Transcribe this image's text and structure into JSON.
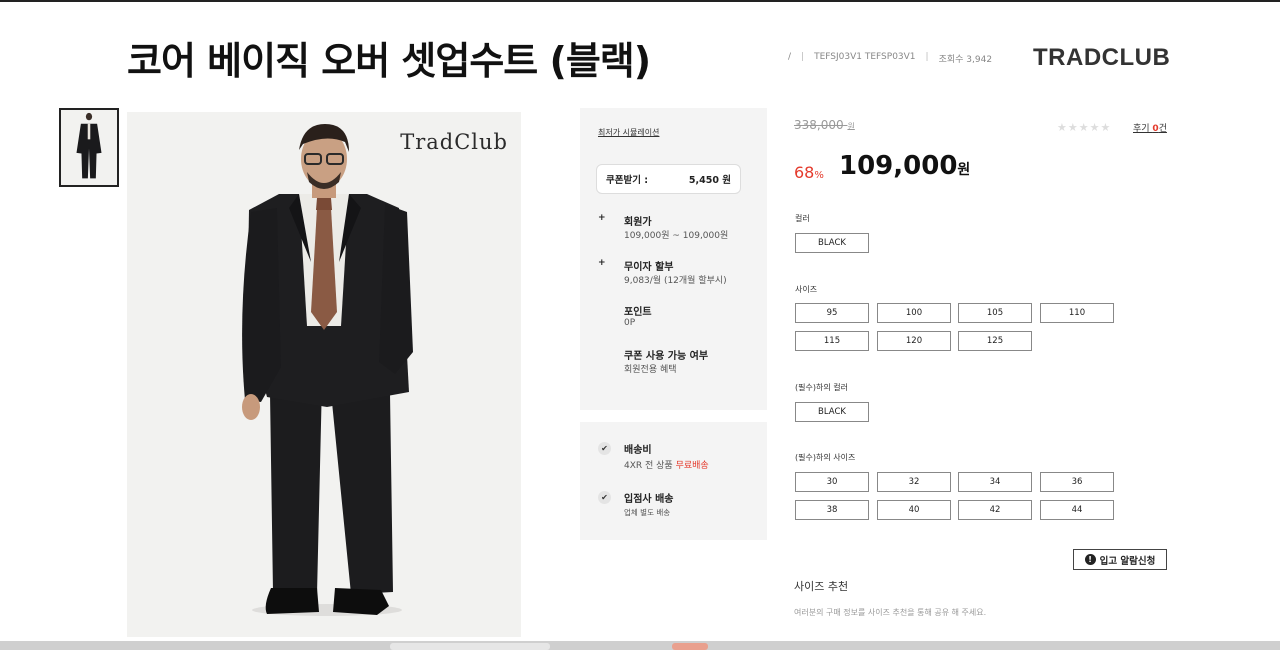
{
  "product": {
    "title": "코어 베이직 오버 셋업수트 (블랙)",
    "slash": "/",
    "bar": "|",
    "code": "TEFSJ03V1 TEFSP03V1",
    "views": "조회수 3,942",
    "brand": "TRADCLUB",
    "image_watermark": "TradClub"
  },
  "info": {
    "simulation_link": "최저가 시뮬레이션",
    "coupon_label": "쿠폰받기 :",
    "coupon_value": "5,450 원",
    "benefits": [
      {
        "plus": "+",
        "title": "회원가",
        "sub": "109,000원 ~ 109,000원"
      },
      {
        "plus": "+",
        "title": "무이자 할부",
        "sub": "9,083/월 (12개월 할부시)"
      },
      {
        "plus": "",
        "title": "포인트",
        "sub": "0P"
      },
      {
        "plus": "",
        "title": "쿠폰 사용 가능 여부",
        "sub": "회원전용 혜택"
      }
    ]
  },
  "shipping": {
    "fee_title": "배송비",
    "fee_prefix": "4XR 전 상품 ",
    "fee_free": "무료배송",
    "vendor_title": "입점사 배송",
    "vendor_sub": "업체 별도 배송"
  },
  "price": {
    "original": "338,000",
    "original_unit": "원",
    "discount_value": "68",
    "discount_unit": "%",
    "current": "109,000",
    "current_unit": "원",
    "stars": "★★★★★",
    "rating_stars": 0,
    "review_prefix": "후기 ",
    "review_count": "0",
    "review_suffix": "건"
  },
  "options": {
    "color_label": "컬러",
    "color_value": "BLACK",
    "size_label": "사이즈",
    "sizes": [
      "95",
      "100",
      "105",
      "110",
      "115",
      "120",
      "125"
    ],
    "bottom_color_label": "(필수)하의 컬러",
    "bottom_color_value": "BLACK",
    "bottom_size_label": "(필수)하의 사이즈",
    "bottom_sizes": [
      "30",
      "32",
      "34",
      "36",
      "38",
      "40",
      "42",
      "44"
    ]
  },
  "notify_label": "입고 알람신청",
  "size_recommend": {
    "title": "사이즈 추천",
    "description": "여러분의 구매 정보를 사이즈 추천을 통해 공유 해 주세요."
  },
  "colors": {
    "accent_red": "#e43a2c",
    "suit": "#1a1a1c"
  },
  "icons": {
    "check": "check-icon",
    "notify": "info-icon"
  }
}
